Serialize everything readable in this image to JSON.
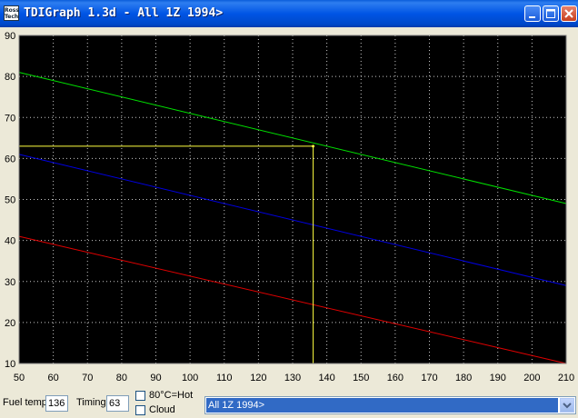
{
  "window": {
    "title": "TDIGraph 1.3d - All 1Z 1994>",
    "icon_label_1": "Ross",
    "icon_label_2": "Tech"
  },
  "controls": {
    "fuel_temp_label": "Fuel temp",
    "fuel_temp_value": "136",
    "timing_label": "Timing",
    "timing_value": "63",
    "hot_label": "80°C=Hot",
    "cloud_label": "Cloud",
    "engine_select_value": "All 1Z 1994>"
  },
  "colors": {
    "plot_background": "#000000",
    "grid": "#C8C8C8",
    "axis_text": "#000000",
    "selection": "#FFFF40",
    "selection_window": "#316AC5"
  },
  "chart_data": {
    "type": "line",
    "title": "",
    "xlabel": "",
    "ylabel": "",
    "xlim": [
      50,
      210
    ],
    "ylim": [
      10,
      90
    ],
    "x_ticks": [
      50,
      60,
      70,
      80,
      90,
      100,
      110,
      120,
      130,
      140,
      150,
      160,
      170,
      180,
      190,
      200,
      210
    ],
    "y_ticks": [
      10,
      20,
      30,
      40,
      50,
      60,
      70,
      80,
      90
    ],
    "grid": true,
    "series": [
      {
        "color": "#00E000",
        "x": [
          50,
          210
        ],
        "y": [
          81,
          49
        ]
      },
      {
        "color": "#0000E0",
        "x": [
          50,
          210
        ],
        "y": [
          61,
          29
        ]
      },
      {
        "color": "#E00000",
        "x": [
          50,
          210
        ],
        "y": [
          41,
          10
        ]
      }
    ],
    "marker": {
      "x": 136,
      "y": 63,
      "color": "#FFFF40"
    }
  }
}
